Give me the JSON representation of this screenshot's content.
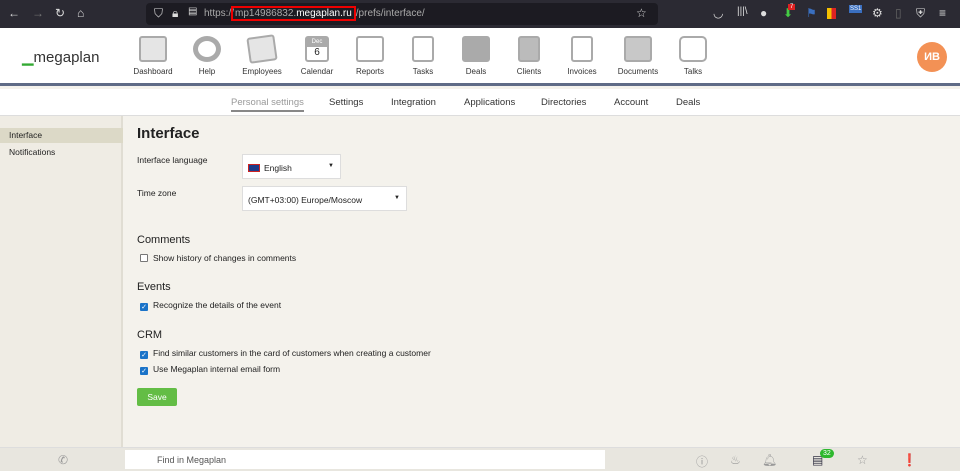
{
  "browser": {
    "url_prefix": "https://",
    "url_host_sub": "mp14986832.",
    "url_host_domain": "megaplan.ru",
    "url_path": "/prefs/interface/",
    "ext_badge": "7",
    "ext_label": "SS1"
  },
  "header": {
    "logo": "megaplan",
    "avatar": "ИВ",
    "nav": [
      {
        "label": "Dashboard"
      },
      {
        "label": "Help"
      },
      {
        "label": "Employees"
      },
      {
        "label": "Calendar",
        "month": "Dec",
        "day": "6"
      },
      {
        "label": "Reports"
      },
      {
        "label": "Tasks"
      },
      {
        "label": "Deals"
      },
      {
        "label": "Clients"
      },
      {
        "label": "Invoices"
      },
      {
        "label": "Documents"
      },
      {
        "label": "Talks"
      }
    ]
  },
  "tabs": [
    {
      "label": "Personal settings",
      "active": true
    },
    {
      "label": "Settings"
    },
    {
      "label": "Integration"
    },
    {
      "label": "Applications"
    },
    {
      "label": "Directories"
    },
    {
      "label": "Account"
    },
    {
      "label": "Deals"
    }
  ],
  "sidebar": {
    "items": [
      {
        "label": "Interface",
        "selected": true
      },
      {
        "label": "Notifications"
      }
    ]
  },
  "main": {
    "title": "Interface",
    "language_label": "Interface language",
    "language_value": "English",
    "timezone_label": "Time zone",
    "timezone_value": "(GMT+03:00) Europe/Moscow",
    "comments_title": "Comments",
    "comments_history": {
      "label": "Show history of changes in comments",
      "checked": false
    },
    "events_title": "Events",
    "events_recognize": {
      "label": "Recognize the details of the event",
      "checked": true
    },
    "crm_title": "CRM",
    "crm_similar": {
      "label": "Find similar customers in the card of customers when creating a customer",
      "checked": true
    },
    "crm_email": {
      "label": "Use Megaplan internal email form",
      "checked": true
    },
    "save_label": "Save"
  },
  "footer": {
    "search_placeholder": "Find in Megaplan",
    "messages_count": "32"
  },
  "colors": {
    "accent": "#63bd45",
    "avatar": "#f39155",
    "checkbox": "#1a73c8"
  }
}
